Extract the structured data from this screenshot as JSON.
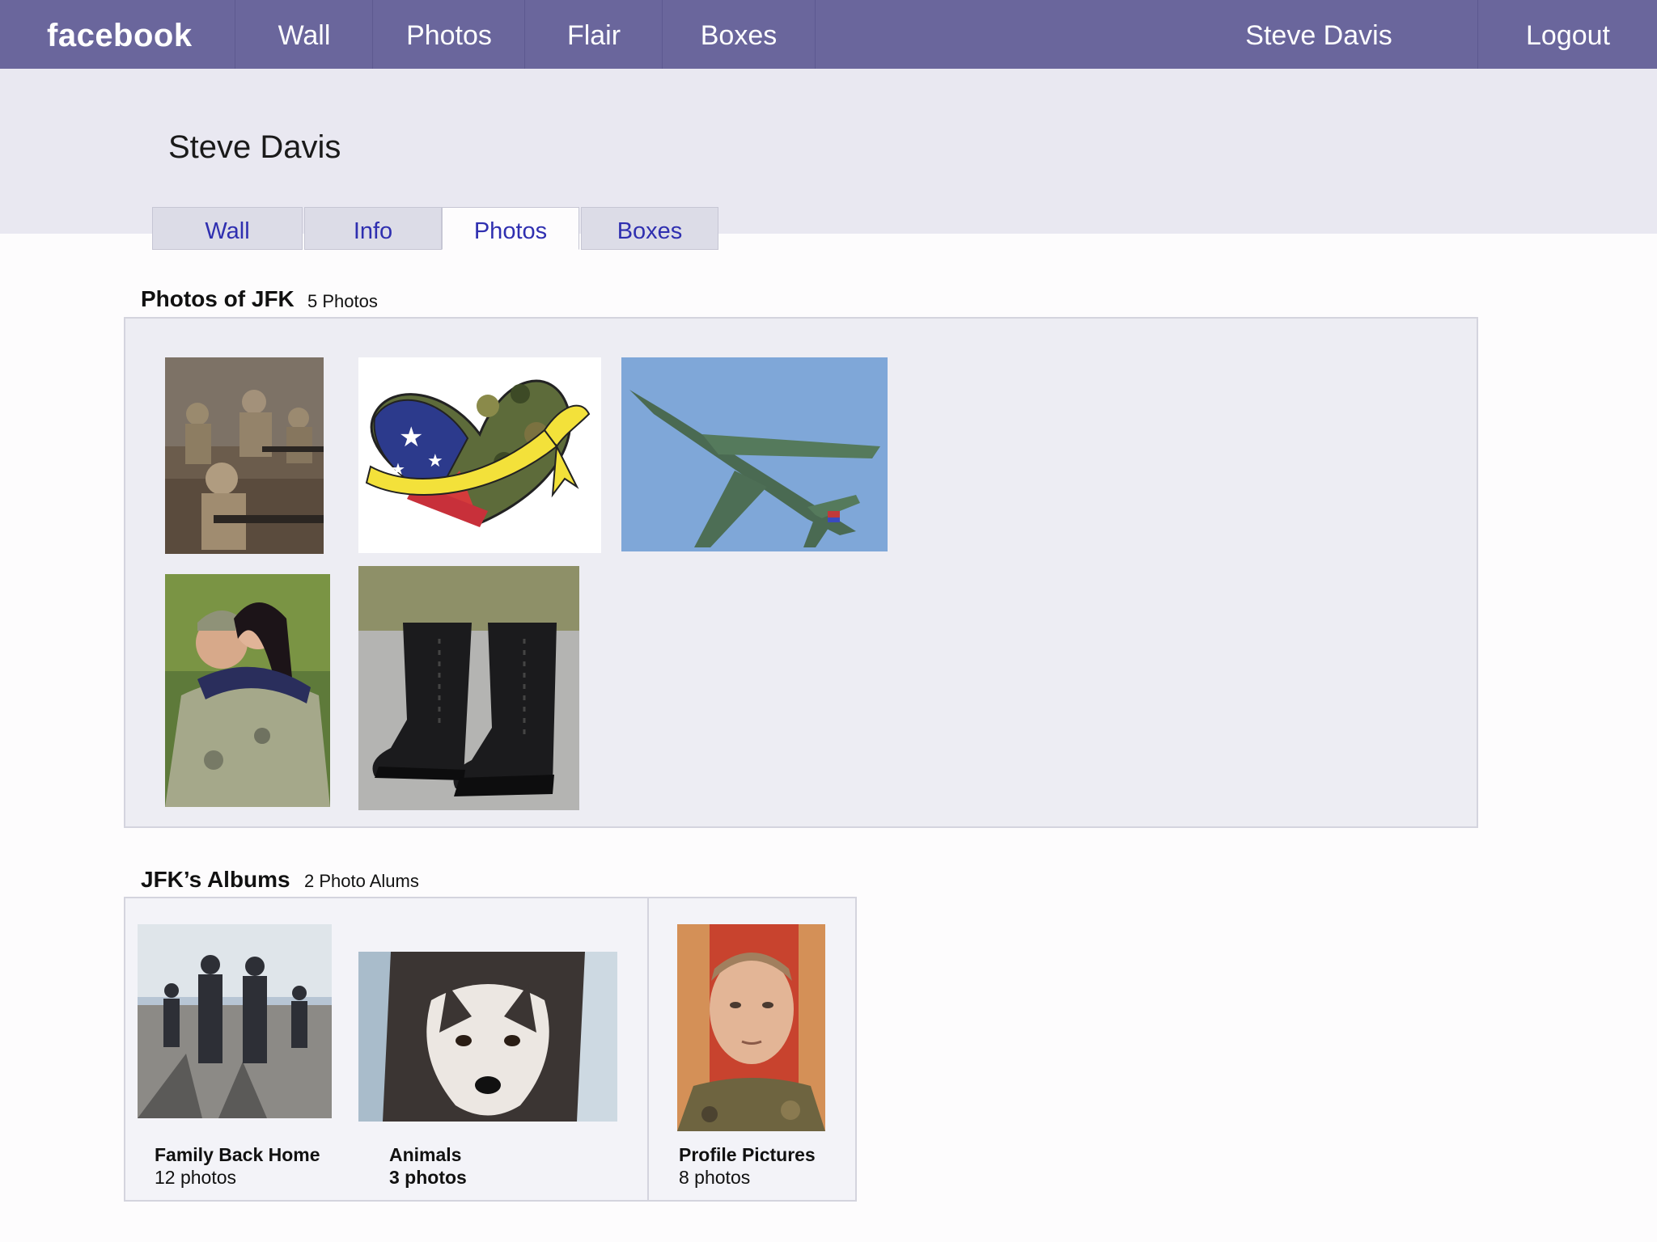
{
  "topbar": {
    "brand": "facebook",
    "nav": [
      "Wall",
      "Photos",
      "Flair",
      "Boxes"
    ],
    "user": "Steve Davis",
    "logout": "Logout"
  },
  "profile": {
    "name": "Steve Davis",
    "tabs": [
      "Wall",
      "Info",
      "Photos",
      "Boxes"
    ],
    "active_tab": "Photos"
  },
  "photos_section": {
    "title": "Photos of JFK",
    "count": "5 Photos"
  },
  "albums_section": {
    "title": "JFK’s Albums",
    "count": "2 Photo Alums",
    "albums": [
      {
        "name": "Family Back Home",
        "count": "12 photos"
      },
      {
        "name": "Animals",
        "count": "3 photos"
      },
      {
        "name": "Profile Pictures",
        "count": "8 photos"
      }
    ]
  },
  "colors": {
    "topbar": "#6a669c",
    "header_band": "#e9e8f1",
    "link": "#2f2fb0"
  },
  "icons": [
    "soldiers-photo",
    "camo-heart-photo",
    "jet-photo",
    "couple-photo",
    "boots-photo",
    "family-album-cover",
    "husky-album-cover",
    "profile-album-cover"
  ]
}
